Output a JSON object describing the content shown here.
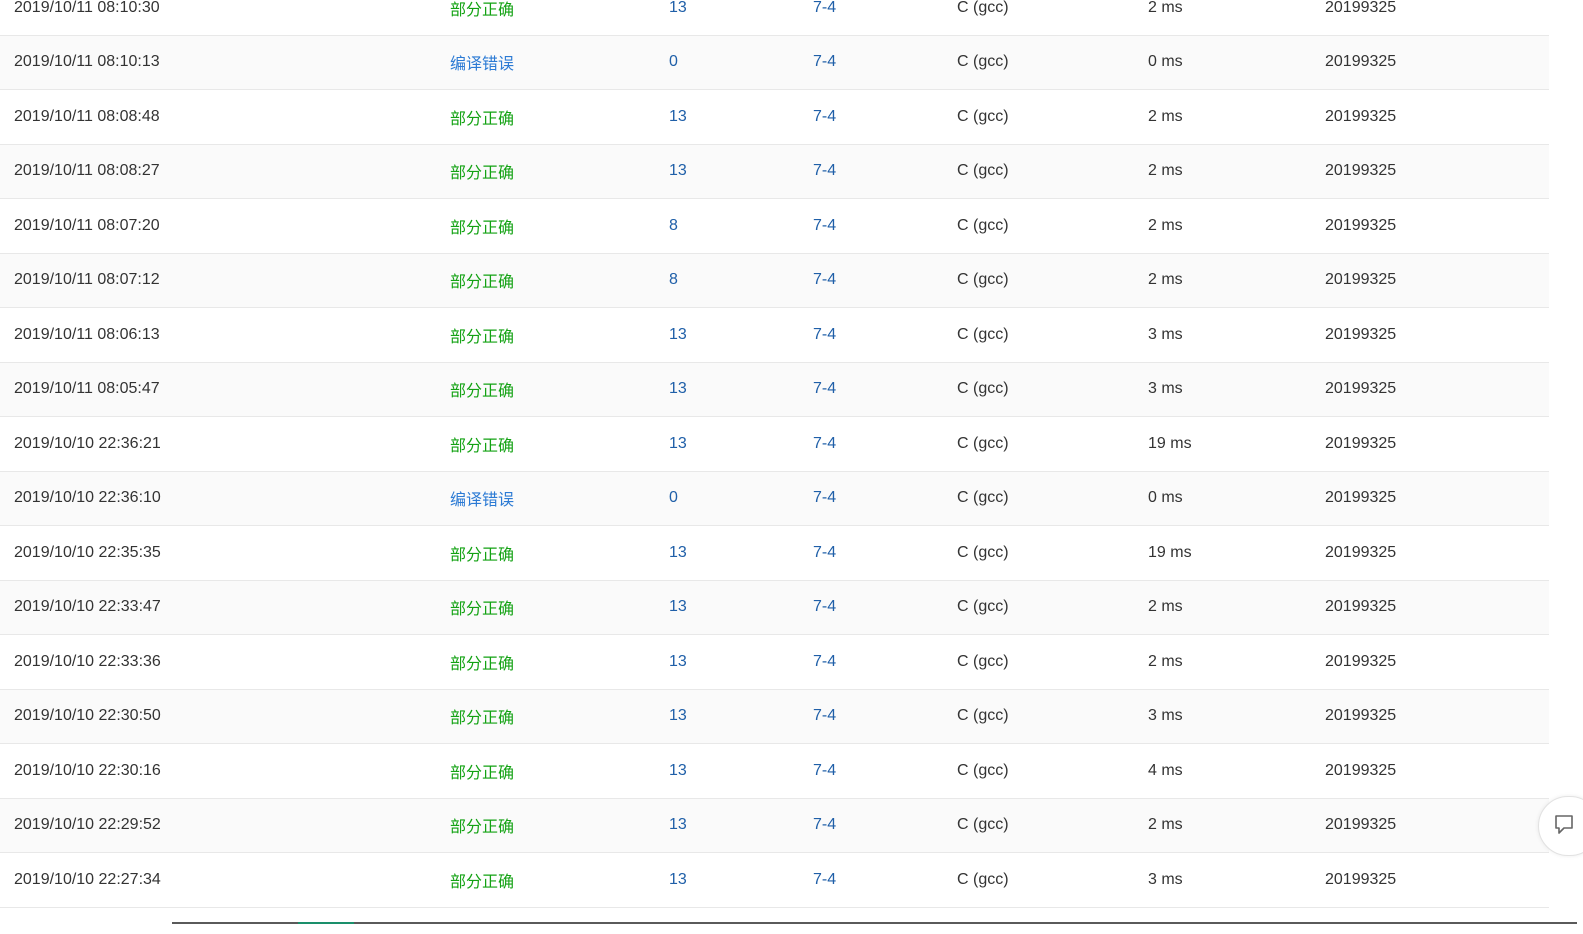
{
  "submissions": [
    {
      "time": "2019/10/11 08:10:30",
      "status": "部分正确",
      "status_type": "partial",
      "score": "13",
      "problem": "7-4",
      "compiler": "C (gcc)",
      "time_used": "2 ms",
      "user": "20199325"
    },
    {
      "time": "2019/10/11 08:10:13",
      "status": "编译错误",
      "status_type": "compile",
      "score": "0",
      "problem": "7-4",
      "compiler": "C (gcc)",
      "time_used": "0 ms",
      "user": "20199325"
    },
    {
      "time": "2019/10/11 08:08:48",
      "status": "部分正确",
      "status_type": "partial",
      "score": "13",
      "problem": "7-4",
      "compiler": "C (gcc)",
      "time_used": "2 ms",
      "user": "20199325"
    },
    {
      "time": "2019/10/11 08:08:27",
      "status": "部分正确",
      "status_type": "partial",
      "score": "13",
      "problem": "7-4",
      "compiler": "C (gcc)",
      "time_used": "2 ms",
      "user": "20199325"
    },
    {
      "time": "2019/10/11 08:07:20",
      "status": "部分正确",
      "status_type": "partial",
      "score": "8",
      "problem": "7-4",
      "compiler": "C (gcc)",
      "time_used": "2 ms",
      "user": "20199325"
    },
    {
      "time": "2019/10/11 08:07:12",
      "status": "部分正确",
      "status_type": "partial",
      "score": "8",
      "problem": "7-4",
      "compiler": "C (gcc)",
      "time_used": "2 ms",
      "user": "20199325"
    },
    {
      "time": "2019/10/11 08:06:13",
      "status": "部分正确",
      "status_type": "partial",
      "score": "13",
      "problem": "7-4",
      "compiler": "C (gcc)",
      "time_used": "3 ms",
      "user": "20199325"
    },
    {
      "time": "2019/10/11 08:05:47",
      "status": "部分正确",
      "status_type": "partial",
      "score": "13",
      "problem": "7-4",
      "compiler": "C (gcc)",
      "time_used": "3 ms",
      "user": "20199325"
    },
    {
      "time": "2019/10/10 22:36:21",
      "status": "部分正确",
      "status_type": "partial",
      "score": "13",
      "problem": "7-4",
      "compiler": "C (gcc)",
      "time_used": "19 ms",
      "user": "20199325"
    },
    {
      "time": "2019/10/10 22:36:10",
      "status": "编译错误",
      "status_type": "compile",
      "score": "0",
      "problem": "7-4",
      "compiler": "C (gcc)",
      "time_used": "0 ms",
      "user": "20199325"
    },
    {
      "time": "2019/10/10 22:35:35",
      "status": "部分正确",
      "status_type": "partial",
      "score": "13",
      "problem": "7-4",
      "compiler": "C (gcc)",
      "time_used": "19 ms",
      "user": "20199325"
    },
    {
      "time": "2019/10/10 22:33:47",
      "status": "部分正确",
      "status_type": "partial",
      "score": "13",
      "problem": "7-4",
      "compiler": "C (gcc)",
      "time_used": "2 ms",
      "user": "20199325"
    },
    {
      "time": "2019/10/10 22:33:36",
      "status": "部分正确",
      "status_type": "partial",
      "score": "13",
      "problem": "7-4",
      "compiler": "C (gcc)",
      "time_used": "2 ms",
      "user": "20199325"
    },
    {
      "time": "2019/10/10 22:30:50",
      "status": "部分正确",
      "status_type": "partial",
      "score": "13",
      "problem": "7-4",
      "compiler": "C (gcc)",
      "time_used": "3 ms",
      "user": "20199325"
    },
    {
      "time": "2019/10/10 22:30:16",
      "status": "部分正确",
      "status_type": "partial",
      "score": "13",
      "problem": "7-4",
      "compiler": "C (gcc)",
      "time_used": "4 ms",
      "user": "20199325"
    },
    {
      "time": "2019/10/10 22:29:52",
      "status": "部分正确",
      "status_type": "partial",
      "score": "13",
      "problem": "7-4",
      "compiler": "C (gcc)",
      "time_used": "2 ms",
      "user": "20199325"
    },
    {
      "time": "2019/10/10 22:27:34",
      "status": "部分正确",
      "status_type": "partial",
      "score": "13",
      "problem": "7-4",
      "compiler": "C (gcc)",
      "time_used": "3 ms",
      "user": "20199325"
    }
  ],
  "colors": {
    "partial": "#13a213",
    "compile": "#2b7ad4",
    "link": "#1f5fa8",
    "text": "#333333"
  },
  "icons": {
    "feedback": "feedback-icon"
  }
}
